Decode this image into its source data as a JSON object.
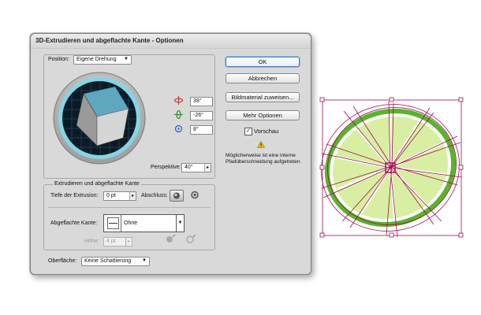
{
  "dialog": {
    "title": "3D-Extrudieren und abgeflachte Kante - Optionen",
    "position_label": "Position:",
    "position_value": "Eigene Drehung",
    "rot_x": "39°",
    "rot_y": "-26°",
    "rot_z": "8°",
    "perspective_label": "Perspektive:",
    "perspective_value": "40°",
    "extrude_group_label": "Extrudieren und abgeflachte Kante",
    "extrude_depth_label": "Tiefe der Extrusion:",
    "extrude_depth_value": "0 pt",
    "cap_label": "Abschluss:",
    "bevel_label": "Abgeflachte Kante:",
    "bevel_value": "Ohne",
    "height_label": "Höhe:",
    "height_value": "4 pt",
    "surface_label": "Oberfläche:",
    "surface_value": "Keine Schattierung",
    "buttons": {
      "ok": "OK",
      "cancel": "Abbrechen",
      "map_art": "Bildmaterial zuweisen...",
      "more_options": "Mehr Optionen"
    },
    "preview_label": "Vorschau",
    "preview_checked": true,
    "warning_text": "Möglicherweise ist eine interne Pfadüberschneidung aufgetreten."
  },
  "colors": {
    "cube_top": "#5fa7bf",
    "cube_side": "#9a9a9a",
    "cube_front": "#d6d6d6",
    "track_ring": "#84d6e6",
    "lime_dark": "#58b42a",
    "lime_flesh": "#d8efa3",
    "selection": "#a01050"
  },
  "icons": {
    "rot_x": "rotate-x-icon",
    "rot_y": "rotate-y-icon",
    "rot_z": "rotate-z-icon",
    "warning": "warning-icon"
  }
}
